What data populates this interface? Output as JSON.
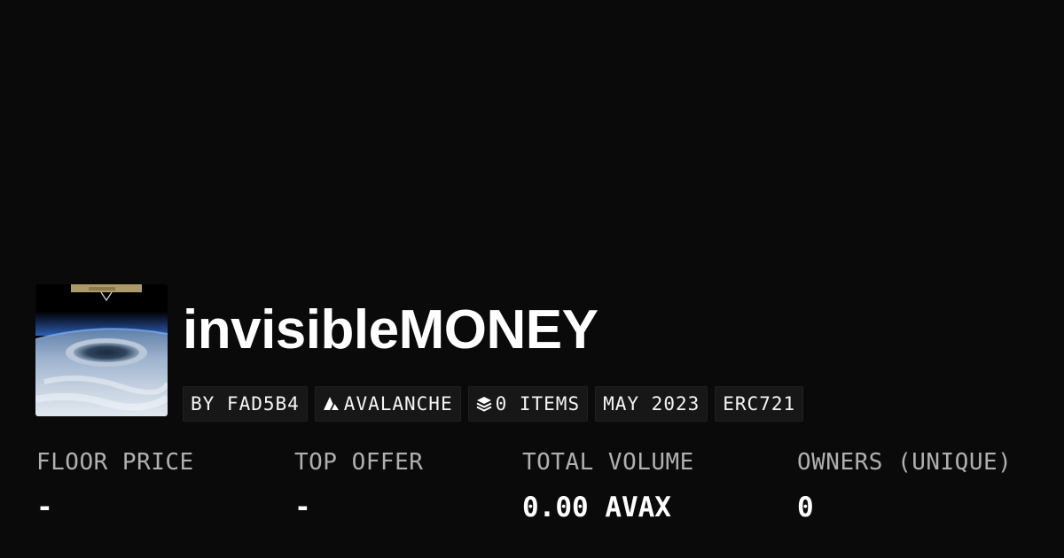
{
  "collection": {
    "title": "invisibleMONEY",
    "thumbnail_icon": "collection-image"
  },
  "tags": {
    "creator": "BY FAD5B4",
    "chain": "AVALANCHE",
    "chain_icon": "avalanche-icon",
    "items": "0 ITEMS",
    "items_icon": "layers-icon",
    "date": "MAY 2023",
    "standard": "ERC721"
  },
  "stats": {
    "floor_price": {
      "label": "FLOOR PRICE",
      "value": "-"
    },
    "top_offer": {
      "label": "TOP OFFER",
      "value": "-"
    },
    "total_volume": {
      "label": "TOTAL VOLUME",
      "value": "0.00 AVAX"
    },
    "owners": {
      "label": "OWNERS (UNIQUE)",
      "value": "0"
    }
  },
  "colors": {
    "background": "#0a0a0a",
    "tag_background": "#171717",
    "label": "#b0b0b0",
    "text": "#ffffff"
  }
}
